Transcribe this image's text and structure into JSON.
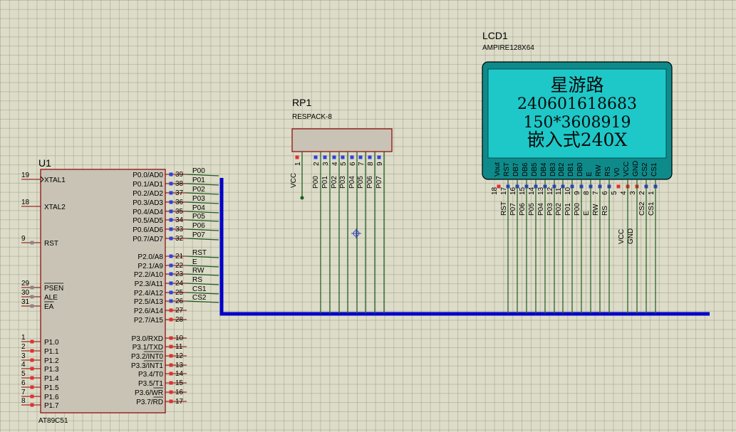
{
  "u1": {
    "ref": "U1",
    "part": "AT89C51",
    "left_pins": [
      {
        "num": "19",
        "name": "XTAL1"
      },
      {
        "num": "18",
        "name": "XTAL2"
      },
      {
        "num": "9",
        "name": "RST"
      },
      {
        "num": "29",
        "name": "PSEN"
      },
      {
        "num": "30",
        "name": "ALE"
      },
      {
        "num": "31",
        "name": "EA"
      },
      {
        "num": "1",
        "name": "P1.0"
      },
      {
        "num": "2",
        "name": "P1.1"
      },
      {
        "num": "3",
        "name": "P1.2"
      },
      {
        "num": "4",
        "name": "P1.3"
      },
      {
        "num": "5",
        "name": "P1.4"
      },
      {
        "num": "6",
        "name": "P1.5"
      },
      {
        "num": "7",
        "name": "P1.6"
      },
      {
        "num": "8",
        "name": "P1.7"
      }
    ],
    "right_pins": [
      {
        "num": "39",
        "name": "P0.0/AD0",
        "net": "P00"
      },
      {
        "num": "38",
        "name": "P0.1/AD1",
        "net": "P01"
      },
      {
        "num": "37",
        "name": "P0.2/AD2",
        "net": "P02"
      },
      {
        "num": "36",
        "name": "P0.3/AD3",
        "net": "P03"
      },
      {
        "num": "35",
        "name": "P0.4/AD4",
        "net": "P04"
      },
      {
        "num": "34",
        "name": "P0.5/AD5",
        "net": "P05"
      },
      {
        "num": "33",
        "name": "P0.6/AD6",
        "net": "P06"
      },
      {
        "num": "32",
        "name": "P0.7/AD7",
        "net": "P07"
      },
      {
        "num": "21",
        "name": "P2.0/A8",
        "net": "RST"
      },
      {
        "num": "22",
        "name": "P2.1/A9",
        "net": "E"
      },
      {
        "num": "23",
        "name": "P2.2/A10",
        "net": "RW"
      },
      {
        "num": "24",
        "name": "P2.3/A11",
        "net": "RS"
      },
      {
        "num": "25",
        "name": "P2.4/A12",
        "net": "CS1"
      },
      {
        "num": "26",
        "name": "P2.5/A13",
        "net": "CS2"
      },
      {
        "num": "27",
        "name": "P2.6/A14",
        "net": ""
      },
      {
        "num": "28",
        "name": "P2.7/A15",
        "net": ""
      },
      {
        "num": "10",
        "name": "P3.0/RXD",
        "net": ""
      },
      {
        "num": "11",
        "name": "P3.1/TXD",
        "net": ""
      },
      {
        "num": "12",
        "name": "P3.2/INT0",
        "net": ""
      },
      {
        "num": "13",
        "name": "P3.3/INT1",
        "net": ""
      },
      {
        "num": "14",
        "name": "P3.4/T0",
        "net": ""
      },
      {
        "num": "15",
        "name": "P3.5/T1",
        "net": ""
      },
      {
        "num": "16",
        "name": "P3.6/WR",
        "net": ""
      },
      {
        "num": "17",
        "name": "P3.7/RD",
        "net": ""
      }
    ]
  },
  "rp1": {
    "ref": "RP1",
    "part": "RESPACK-8",
    "pins": [
      {
        "num": "1",
        "net": "VCC"
      },
      {
        "num": "2",
        "net": "P00"
      },
      {
        "num": "3",
        "net": "P01"
      },
      {
        "num": "4",
        "net": "P02"
      },
      {
        "num": "5",
        "net": "P03"
      },
      {
        "num": "6",
        "net": "P04"
      },
      {
        "num": "7",
        "net": "P05"
      },
      {
        "num": "8",
        "net": "P06"
      },
      {
        "num": "9",
        "net": "P07"
      }
    ]
  },
  "lcd": {
    "ref": "LCD1",
    "part": "AMPIRE128X64",
    "screen_color": "#1ec8c8",
    "lines": [
      "星游路",
      "240601618683",
      "150*3608919",
      "嵌入式240X"
    ],
    "pins": [
      {
        "num": "18",
        "name": "Vout",
        "net": ""
      },
      {
        "num": "17",
        "name": "RST",
        "net": "RST"
      },
      {
        "num": "16",
        "name": "DB7",
        "net": "P07"
      },
      {
        "num": "15",
        "name": "DB6",
        "net": "P06"
      },
      {
        "num": "14",
        "name": "DB5",
        "net": "P05"
      },
      {
        "num": "13",
        "name": "DB4",
        "net": "P04"
      },
      {
        "num": "12",
        "name": "DB3",
        "net": "P03"
      },
      {
        "num": "11",
        "name": "DB2",
        "net": "P02"
      },
      {
        "num": "10",
        "name": "DB1",
        "net": "P01"
      },
      {
        "num": "9",
        "name": "DB0",
        "net": "P00"
      },
      {
        "num": "8",
        "name": "E",
        "net": "E"
      },
      {
        "num": "7",
        "name": "RW",
        "net": "RW"
      },
      {
        "num": "6",
        "name": "RS",
        "net": "RS"
      },
      {
        "num": "5",
        "name": "V0",
        "net": ""
      },
      {
        "num": "4",
        "name": "VCC",
        "net": "VCC"
      },
      {
        "num": "3",
        "name": "GND",
        "net": "GND"
      },
      {
        "num": "2",
        "name": "CS2",
        "net": "CS2"
      },
      {
        "num": "1",
        "name": "CS1",
        "net": "CS1"
      }
    ]
  },
  "colors": {
    "bus": "#0000c8",
    "wire": "#1e5a1e",
    "body": "#c8c3b4",
    "outline": "#8b0000",
    "pin_red": "#e03030",
    "pin_blue": "#3040e0"
  }
}
